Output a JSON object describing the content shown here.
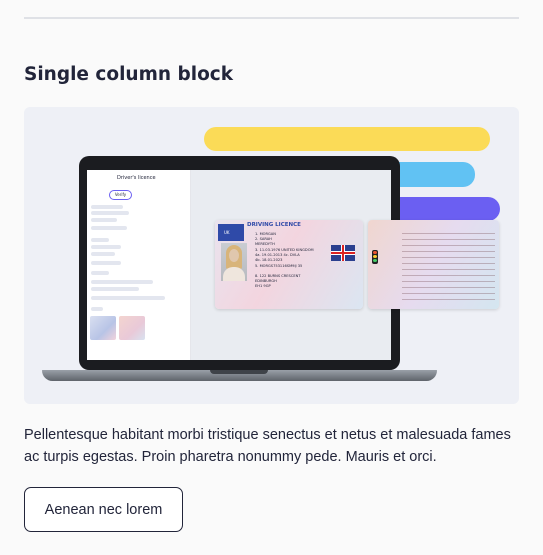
{
  "section": {
    "title": "Single column block",
    "body": "Pellentesque habitant morbi tristique senectus et netus et malesuada fames ac turpis egestas. Proin pharetra nonummy pede. Mauris et orci.",
    "button_label": "Aenean nec lorem"
  },
  "illustration": {
    "panel_title": "Driver's licence",
    "panel_chip": "Verify",
    "licence_header": "DRIVING LICENCE",
    "licence_country": "UK",
    "licence_lines": [
      "1. MORGAN",
      "2. SARAH",
      "   MEREDYTH",
      "3. 11.03.1976 UNITED KINGDOM",
      "4a. 19.01.2013   4c. DVLA",
      "4b. 18.01.2023",
      "5. MORGS753116SM9IJ 35",
      "8. 122 BURNS CRESCENT",
      "   EDINBURGH",
      "   EH1 9GP"
    ],
    "colors": {
      "yellow_bar": "#fbdb57",
      "blue_bar": "#61c2f3",
      "purple_bar": "#6b5ff2",
      "text": "#22253a"
    }
  }
}
